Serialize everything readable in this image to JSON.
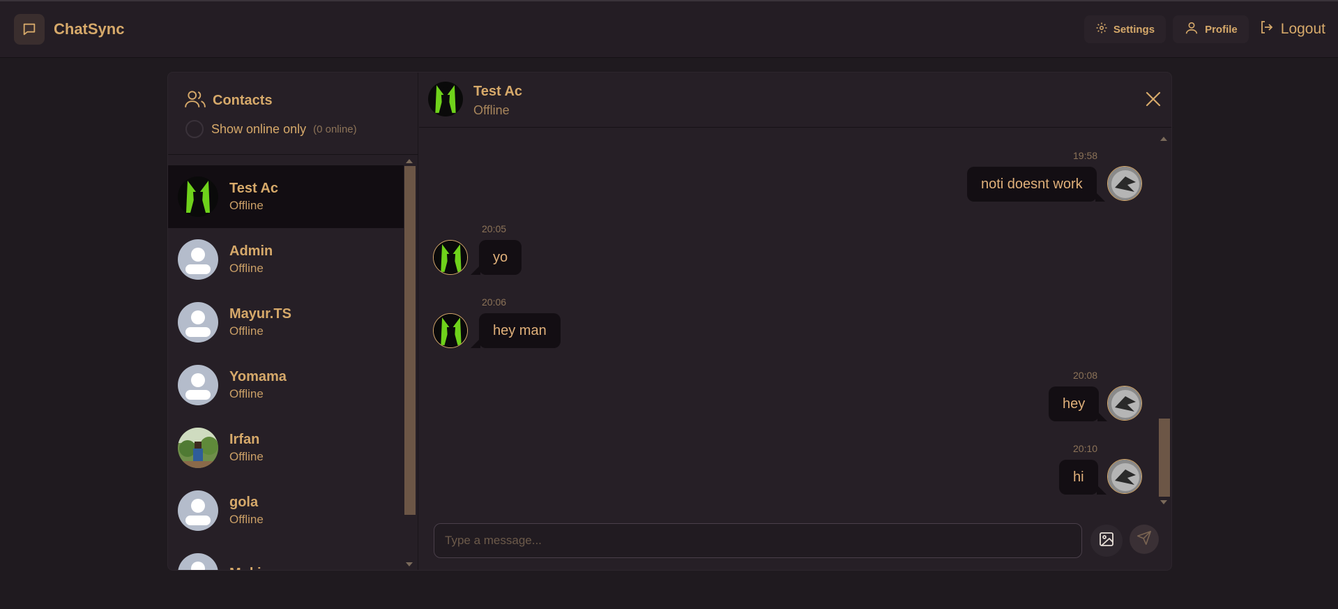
{
  "app": {
    "name": "ChatSync"
  },
  "nav": {
    "settings_label": "Settings",
    "profile_label": "Profile",
    "logout_label": "Logout"
  },
  "sidebar": {
    "title": "Contacts",
    "online_filter_label": "Show online only",
    "online_count": "(0 online)",
    "contacts": [
      {
        "name": "Test Ac",
        "status": "Offline",
        "avatar": "green-silhouette",
        "active": true
      },
      {
        "name": "Admin",
        "status": "Offline",
        "avatar": "default-user"
      },
      {
        "name": "Mayur.TS",
        "status": "Offline",
        "avatar": "default-user"
      },
      {
        "name": "Yomama",
        "status": "Offline",
        "avatar": "default-user"
      },
      {
        "name": "Irfan",
        "status": "Offline",
        "avatar": "photo"
      },
      {
        "name": "gola",
        "status": "Offline",
        "avatar": "default-user"
      },
      {
        "name": "Moki",
        "status": "",
        "avatar": "default-user"
      }
    ]
  },
  "chat": {
    "name": "Test Ac",
    "status": "Offline",
    "messages": [
      {
        "time": "19:58",
        "text": "noti doesnt work",
        "direction": "out"
      },
      {
        "time": "20:05",
        "text": "yo",
        "direction": "in"
      },
      {
        "time": "20:06",
        "text": "hey man",
        "direction": "in"
      },
      {
        "time": "20:08",
        "text": "hey",
        "direction": "out"
      },
      {
        "time": "20:10",
        "text": "hi",
        "direction": "out"
      }
    ],
    "composer_placeholder": "Type a message..."
  },
  "colors": {
    "accent": "#d6a96a",
    "background": "#1f1a1f",
    "panel": "#261f26",
    "bubble": "#130e13"
  }
}
